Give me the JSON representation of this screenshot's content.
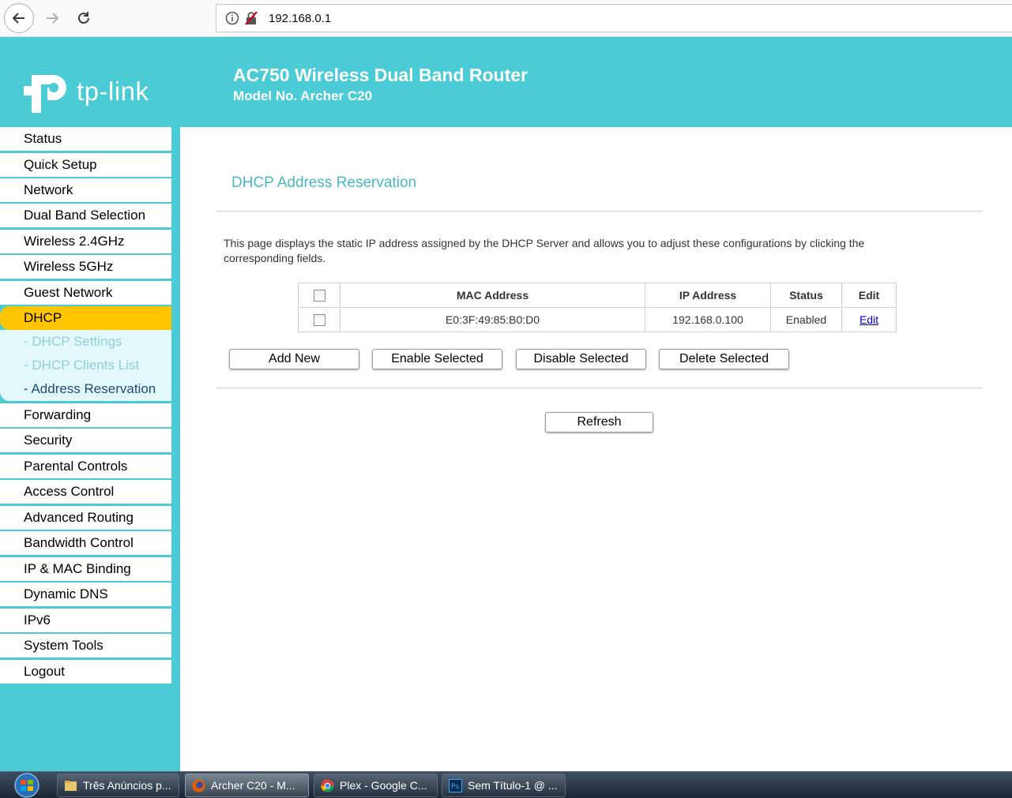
{
  "browser": {
    "url": "192.168.0.1"
  },
  "header": {
    "logo_text": "tp-link",
    "product": "AC750 Wireless Dual Band Router",
    "model": "Model No. Archer C20"
  },
  "sidebar": {
    "items": [
      {
        "label": "Status"
      },
      {
        "label": "Quick Setup"
      },
      {
        "label": "Network"
      },
      {
        "label": "Dual Band Selection"
      },
      {
        "label": "Wireless 2.4GHz"
      },
      {
        "label": "Wireless 5GHz"
      },
      {
        "label": "Guest Network"
      },
      {
        "label": "DHCP"
      },
      {
        "label": "Forwarding"
      },
      {
        "label": "Security"
      },
      {
        "label": "Parental Controls"
      },
      {
        "label": "Access Control"
      },
      {
        "label": "Advanced Routing"
      },
      {
        "label": "Bandwidth Control"
      },
      {
        "label": "IP & MAC Binding"
      },
      {
        "label": "Dynamic DNS"
      },
      {
        "label": "IPv6"
      },
      {
        "label": "System Tools"
      },
      {
        "label": "Logout"
      }
    ],
    "active": "DHCP",
    "sub_items": [
      {
        "label": "- DHCP Settings"
      },
      {
        "label": "- DHCP Clients List"
      },
      {
        "label": "- Address Reservation"
      }
    ]
  },
  "main": {
    "title": "DHCP Address Reservation",
    "description": "This page displays the static IP address assigned by the DHCP Server and allows you to adjust these configurations by clicking the corresponding fields.",
    "table": {
      "headers": [
        "MAC Address",
        "IP Address",
        "Status",
        "Edit"
      ],
      "rows": [
        {
          "mac": "E0:3F:49:85:B0:D0",
          "ip": "192.168.0.100",
          "status": "Enabled",
          "edit": "Edit"
        }
      ]
    },
    "buttons": {
      "add_new": "Add New",
      "enable_selected": "Enable Selected",
      "disable_selected": "Disable Selected",
      "delete_selected": "Delete Selected",
      "refresh": "Refresh"
    }
  },
  "taskbar": {
    "tasks": [
      {
        "label": "Três Anúncios p..."
      },
      {
        "label": "Archer C20 - M..."
      },
      {
        "label": "Plex - Google C..."
      },
      {
        "label": "Sem Título-1 @ ..."
      }
    ]
  },
  "colors": {
    "brand": "#4acbd6",
    "active_menu": "#ffc500",
    "title": "#4ab7c4"
  }
}
